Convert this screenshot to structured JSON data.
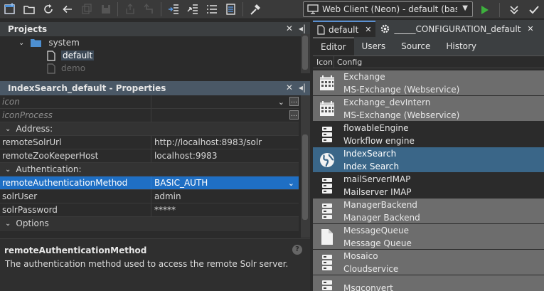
{
  "toolbar": {
    "connection_label": "Web Client (Neon) - default (basi…"
  },
  "projects_panel": {
    "title": "Projects",
    "tree": [
      {
        "label": "system",
        "level": 0,
        "expanded": true
      },
      {
        "label": "default",
        "level": 1,
        "selected": true
      },
      {
        "label": "demo",
        "level": 1,
        "dimmed": true
      }
    ]
  },
  "properties_panel": {
    "title": "IndexSearch_default - Properties",
    "rows": [
      {
        "type": "prop",
        "key": "icon",
        "value": "",
        "italic": true,
        "dropdown": true
      },
      {
        "type": "prop",
        "key": "iconProcess",
        "value": "",
        "italic": true
      },
      {
        "type": "group",
        "key": "Address:"
      },
      {
        "type": "prop",
        "key": "remoteSolrUrl",
        "value": "http://localhost:8983/solr"
      },
      {
        "type": "prop",
        "key": "remoteZooKeeperHost",
        "value": "localhost:9983"
      },
      {
        "type": "group",
        "key": "Authentication:"
      },
      {
        "type": "prop",
        "key": "remoteAuthenticationMethod",
        "value": "BASIC_AUTH",
        "selected": true,
        "dropdown": true
      },
      {
        "type": "prop",
        "key": "solrUser",
        "value": "admin"
      },
      {
        "type": "prop",
        "key": "solrPassword",
        "value": "*****"
      },
      {
        "type": "group",
        "key": "Options"
      }
    ],
    "description_title": "remoteAuthenticationMethod",
    "description_text": "The authentication method used to access the remote Solr server."
  },
  "editor": {
    "tabs": [
      {
        "label": "default",
        "active": true
      },
      {
        "label": "_____CONFIGURATION_default",
        "active": false
      }
    ],
    "subtabs": [
      "Editor",
      "Users",
      "Source",
      "History"
    ],
    "active_subtab": "Editor",
    "columns": {
      "icon": "Icon",
      "config": "Config"
    },
    "configs": [
      {
        "name": "Exchange",
        "desc": "MS-Exchange (Webservice)",
        "icon": "calendar-icon",
        "style": "grey"
      },
      {
        "name": "Exchange_devIntern",
        "desc": "MS-Exchange (Webservice)",
        "icon": "calendar-icon",
        "style": "grey"
      },
      {
        "name": "flowableEngine",
        "desc": "Workflow engine",
        "icon": "server-icon",
        "style": "dark"
      },
      {
        "name": "IndexSearch",
        "desc": "Index Search",
        "icon": "globe-icon",
        "style": "hl"
      },
      {
        "name": "mailServerIMAP",
        "desc": "Mailserver IMAP",
        "icon": "server-icon",
        "style": "dark"
      },
      {
        "name": "ManagerBackend",
        "desc": "Manager Backend",
        "icon": "server-icon",
        "style": "grey"
      },
      {
        "name": "MessageQueue",
        "desc": "Message Queue",
        "icon": "document-icon",
        "style": "grey"
      },
      {
        "name": "Mosaico",
        "desc": "Cloudservice",
        "icon": "server-icon",
        "style": "grey"
      },
      {
        "name": "Msgconvert",
        "desc": "",
        "icon": "server-icon",
        "style": "grey"
      }
    ]
  }
}
